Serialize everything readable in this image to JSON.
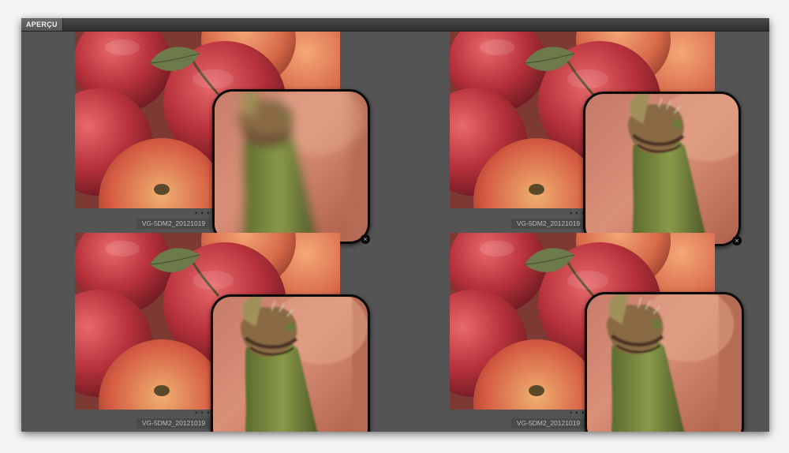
{
  "window": {
    "tab_label": "APERÇU"
  },
  "previews": [
    {
      "filename": "VG-5DM2_20121019",
      "dots": "• • •",
      "loupe_focus": "blurred",
      "close_glyph": "×"
    },
    {
      "filename": "VG-5DM2_20121019",
      "dots": "• • •",
      "loupe_focus": "sharp",
      "close_glyph": "×"
    },
    {
      "filename": "VG-5DM2_20121019",
      "dots": "• • •",
      "loupe_focus": "sharp"
    },
    {
      "filename": "VG-5DM2_20121019",
      "dots": "• • •",
      "loupe_focus": "sharp"
    }
  ],
  "colors": {
    "panel_bg": "#545454",
    "titlebar": "#3a3a3a",
    "loupe_border": "#0a0a0a"
  },
  "icons": [
    "close-icon"
  ]
}
